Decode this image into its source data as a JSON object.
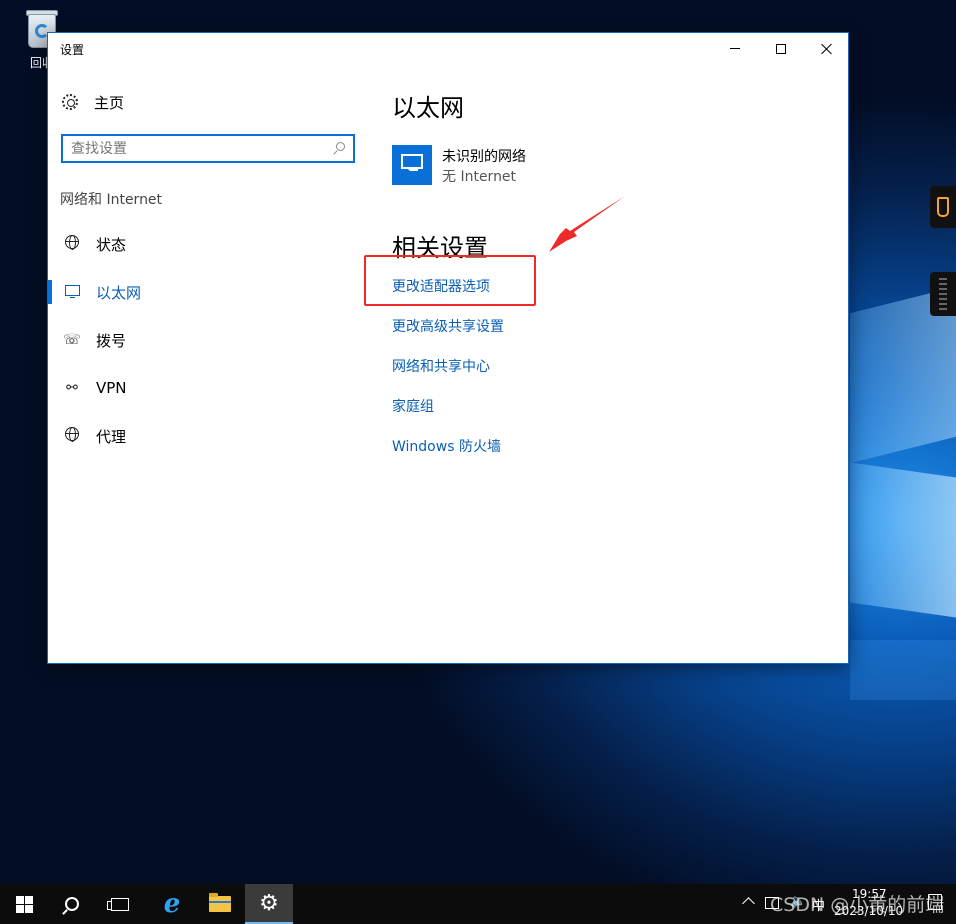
{
  "desktop": {
    "recycle_bin_label": "回收"
  },
  "window": {
    "title": "设置"
  },
  "sidebar": {
    "home_label": "主页",
    "search_placeholder": "查找设置",
    "section_title": "网络和 Internet",
    "items": [
      {
        "label": "状态",
        "icon": "globe-icon",
        "active": false
      },
      {
        "label": "以太网",
        "icon": "ethernet-monitor-icon",
        "active": true
      },
      {
        "label": "拨号",
        "icon": "dialup-icon",
        "active": false
      },
      {
        "label": "VPN",
        "icon": "vpn-icon",
        "active": false
      },
      {
        "label": "代理",
        "icon": "globe-icon",
        "active": false
      }
    ]
  },
  "main": {
    "heading": "以太网",
    "network": {
      "name": "未识别的网络",
      "status": "无 Internet"
    },
    "related_heading": "相关设置",
    "related_links": [
      "更改适配器选项",
      "更改高级共享设置",
      "网络和共享中心",
      "家庭组",
      "Windows 防火墙"
    ]
  },
  "annotation": {
    "highlight_color": "#ee2b2b",
    "target": "更改适配器选项"
  },
  "taskbar": {
    "tray": {
      "volume": "🔈",
      "ime": "中",
      "time": "19:57",
      "date": "2023/10/10"
    }
  },
  "watermark": "CSDN @小黄的前端",
  "colors": {
    "accent": "#0a6fd6",
    "link": "#0a5fb4"
  }
}
